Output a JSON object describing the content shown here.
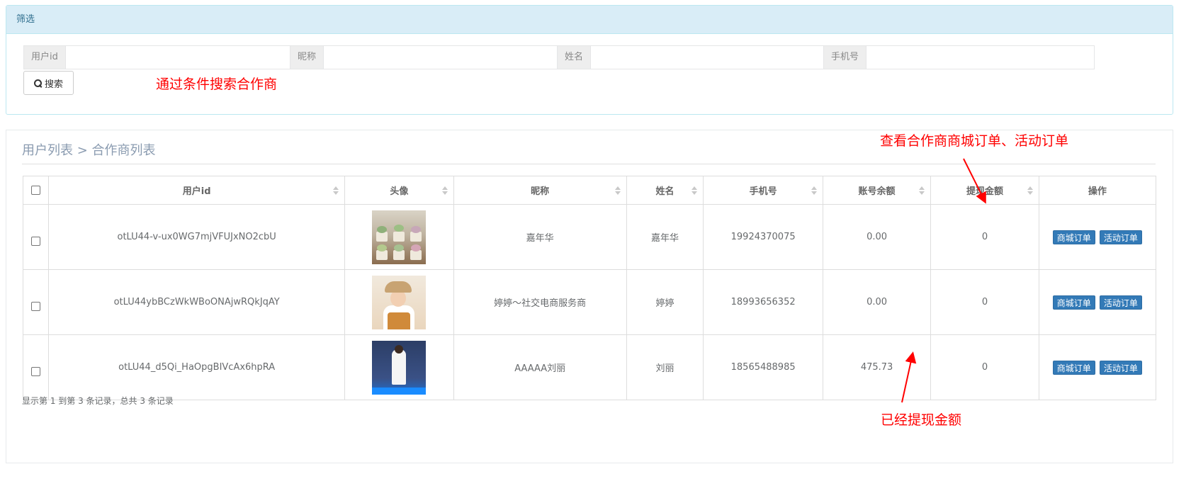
{
  "filter": {
    "heading": "筛选",
    "fields": [
      {
        "label": "用户id",
        "value": "",
        "placeholder": ""
      },
      {
        "label": "昵称",
        "value": "",
        "placeholder": ""
      },
      {
        "label": "姓名",
        "value": "",
        "placeholder": ""
      },
      {
        "label": "手机号",
        "value": "",
        "placeholder": ""
      }
    ],
    "search_label": "搜索"
  },
  "annotations": {
    "search_note": "通过条件搜索合作商",
    "orders_note": "查看合作商商城订单、活动订单",
    "withdrawn_note": "已经提现金额"
  },
  "list": {
    "breadcrumb": "用户列表 > 合作商列表",
    "columns": [
      "用户id",
      "头像",
      "昵称",
      "姓名",
      "手机号",
      "账号余额",
      "提现金额",
      "操作"
    ],
    "rows": [
      {
        "user_id": "otLU44-v-ux0WG7mjVFUJxNO2cbU",
        "avatar": "succulent-plants-photo",
        "nickname": "嘉年华",
        "name": "嘉年华",
        "phone": "19924370075",
        "balance": "0.00",
        "withdrawn": "0"
      },
      {
        "user_id": "otLU44ybBCzWkWBoONAjwRQkJqAY",
        "avatar": "woman-with-hat-photo",
        "nickname": "婷婷～社交电商服务商",
        "name": "婷婷",
        "phone": "18993656352",
        "balance": "0.00",
        "withdrawn": "0"
      },
      {
        "user_id": "otLU44_d5Qi_HaOpgBIVcAx6hpRA",
        "avatar": "woman-poster-photo",
        "nickname": "AAAAA刘丽",
        "name": "刘丽",
        "phone": "18565488985",
        "balance": "475.73",
        "withdrawn": "0"
      }
    ],
    "actions": {
      "mall_orders": "商城订单",
      "activity_orders": "活动订单"
    },
    "footer": "显示第 1 到第 3 条记录，总共 3 条记录"
  },
  "colors": {
    "heading_bg": "#d9edf7",
    "primary_button": "#337ab7",
    "annotation_red": "#ff0000"
  }
}
